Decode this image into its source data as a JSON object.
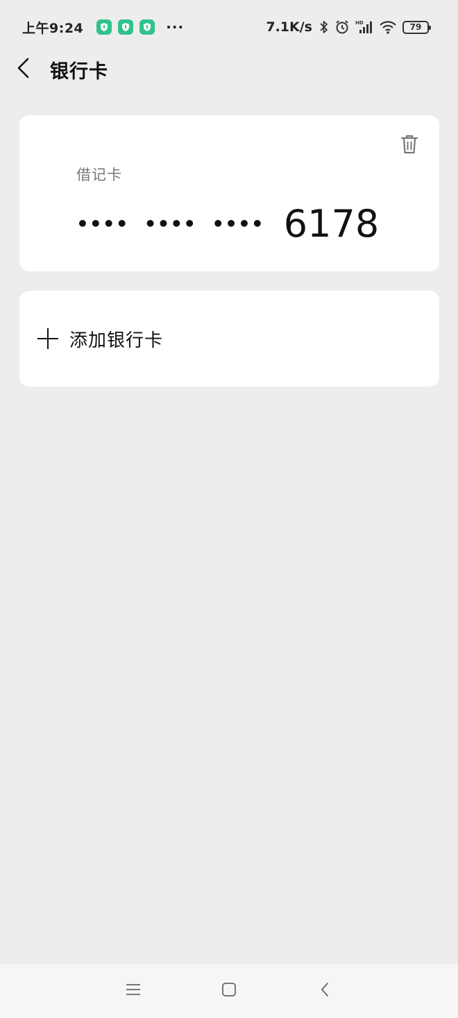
{
  "status_bar": {
    "time": "上午9:24",
    "dots": "···",
    "net_speed": "7.1K/s",
    "battery": "79",
    "accent_color": "#2fc38b"
  },
  "header": {
    "title": "银行卡",
    "back_icon": "chevron-left-icon"
  },
  "bank_card": {
    "type": "借记卡",
    "masked_groups": [
      "••••",
      "••••",
      "••••"
    ],
    "last4": "6178",
    "delete_icon": "trash-icon"
  },
  "add_card": {
    "label": "添加银行卡",
    "icon": "plus-icon"
  },
  "nav_bar": {
    "items": [
      "menu-icon",
      "home-icon",
      "back-icon"
    ]
  }
}
